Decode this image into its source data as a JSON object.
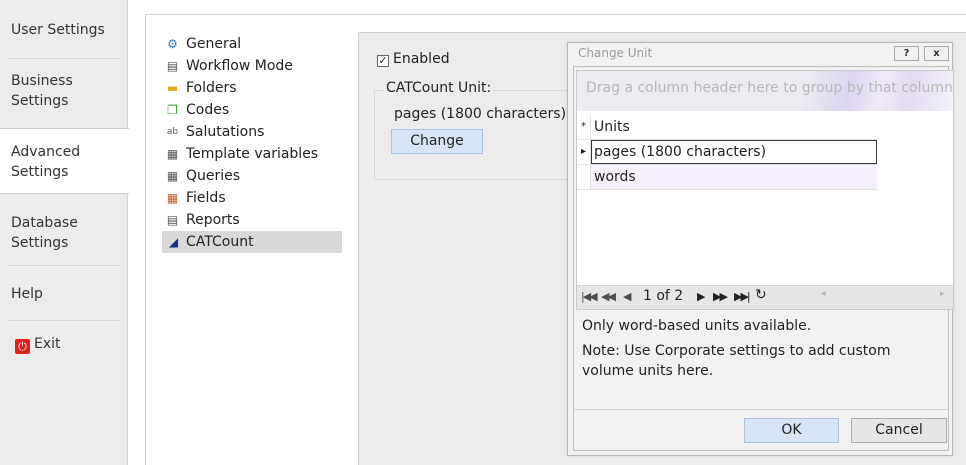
{
  "nav": {
    "items": [
      {
        "label_line1": "User Settings",
        "label_line2": ""
      },
      {
        "label_line1": "Business",
        "label_line2": "Settings"
      },
      {
        "label_line1": "Advanced",
        "label_line2": "Settings"
      },
      {
        "label_line1": "Database",
        "label_line2": "Settings"
      },
      {
        "label_line1": "Help",
        "label_line2": ""
      }
    ],
    "exit_label": "Exit"
  },
  "tree": {
    "items": [
      {
        "label": "General",
        "icon": "general-icon"
      },
      {
        "label": "Workflow Mode",
        "icon": "workflow-icon"
      },
      {
        "label": "Folders",
        "icon": "folder-icon"
      },
      {
        "label": "Codes",
        "icon": "codes-icon"
      },
      {
        "label": "Salutations",
        "icon": "salutations-icon"
      },
      {
        "label": "Template variables",
        "icon": "template-variables-icon"
      },
      {
        "label": "Queries",
        "icon": "queries-icon"
      },
      {
        "label": "Fields",
        "icon": "fields-icon"
      },
      {
        "label": "Reports",
        "icon": "reports-icon"
      },
      {
        "label": "CATCount",
        "icon": "catcount-icon"
      }
    ],
    "selected": "CATCount"
  },
  "catcount": {
    "enabled_label": "Enabled",
    "enabled_checked": true,
    "unit_group_label": "CATCount Unit:",
    "current_unit": "pages (1800 characters)",
    "change_button": "Change"
  },
  "dialog": {
    "title": "Change Unit",
    "help_button": "?",
    "close_button": "x",
    "group_panel_text": "Drag a column header here to group by that column",
    "new_row_marker": "*",
    "column_header": "Units",
    "rows": [
      "pages (1800 characters)",
      "words"
    ],
    "pager_text": "1 of 2",
    "info_line1": "Only word-based units available.",
    "info_line2": "Note: Use Corporate settings to add custom volume units here.",
    "ok_button": "OK",
    "cancel_button": "Cancel"
  }
}
